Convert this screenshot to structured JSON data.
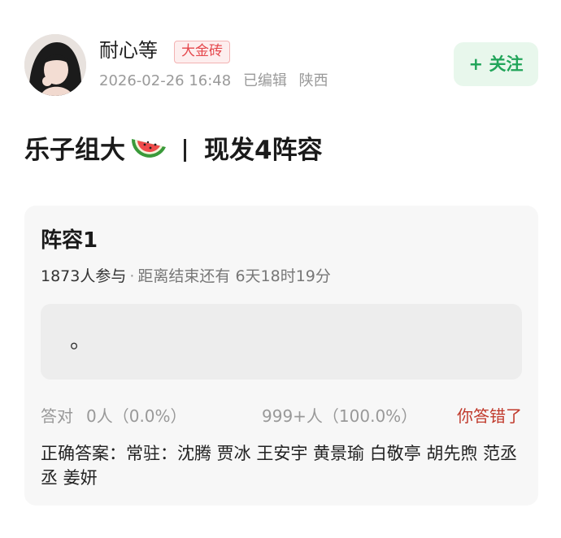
{
  "author": {
    "name": "耐心等",
    "badge": "大金砖",
    "date": "2026-02-26 16:48",
    "edited": "已编辑",
    "location": "陕西",
    "follow_label": "+ 关注"
  },
  "post": {
    "title_prefix": "乐子组大",
    "title_suffix": "现发4阵容"
  },
  "poll": {
    "title": "阵容1",
    "participants": "1873人参与",
    "dot": "·",
    "countdown": "距离结束还有 6天18时19分",
    "option_text": "。",
    "correct_label": "答对",
    "correct_value": "0人（0.0%）",
    "total_value": "999+人（100.0%）",
    "wrong_label": "你答错了",
    "answer": "正确答案：常驻：沈腾 贾冰 王安宇 黄景瑜 白敬亭 胡先煦 范丞丞 姜妍"
  },
  "colors": {
    "follow_green": "#22a55a",
    "follow_bg": "#e8f7ec",
    "badge_red": "#e5484d",
    "wrong_red": "#c0392b"
  }
}
